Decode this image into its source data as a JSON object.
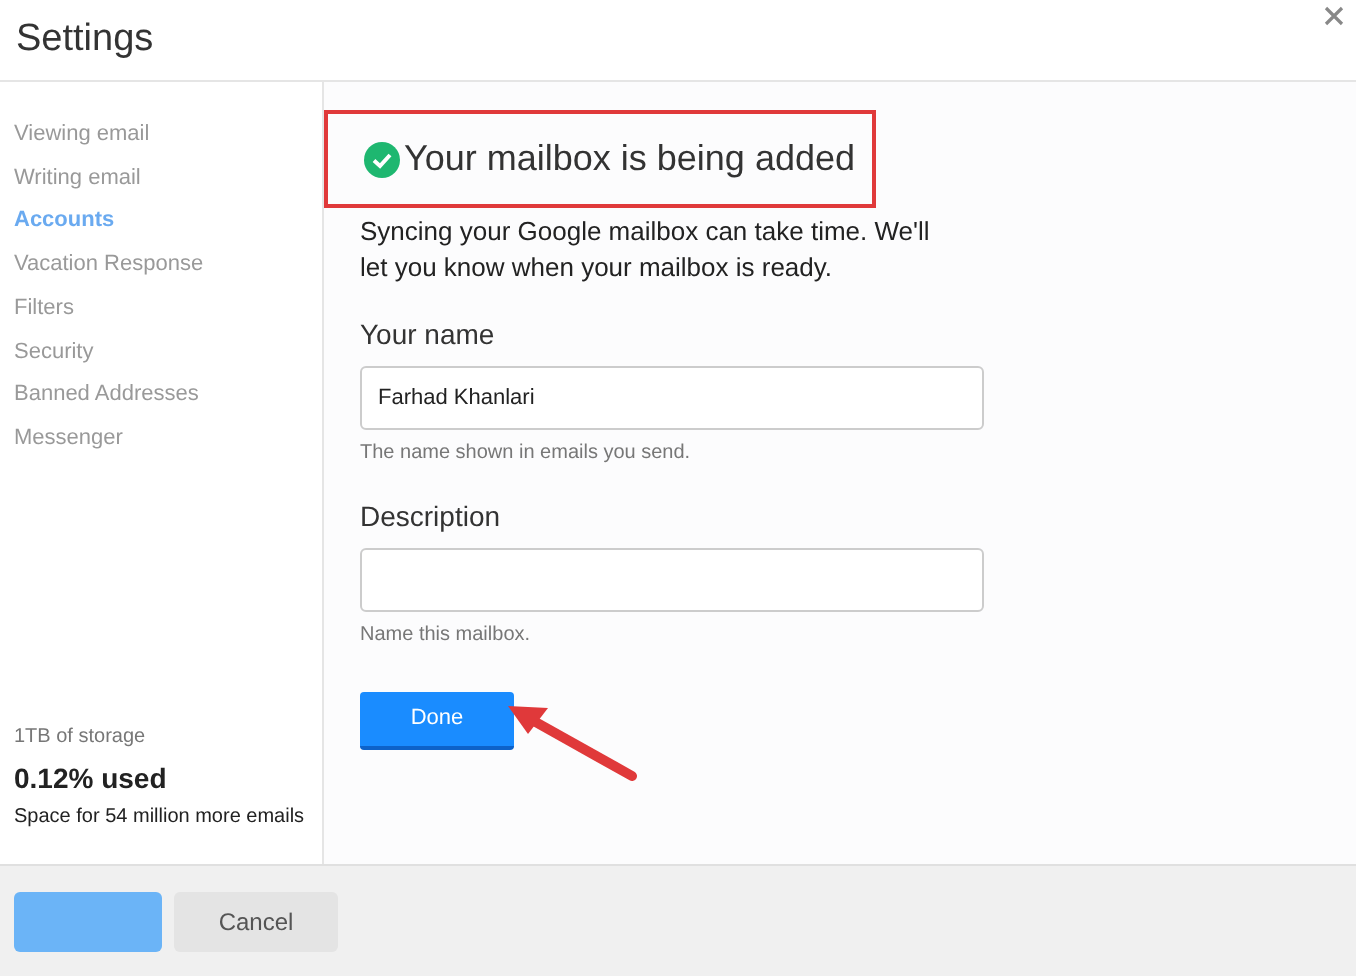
{
  "window": {
    "title": "Settings"
  },
  "sidebar": {
    "items": [
      {
        "label": "Viewing email",
        "selected": false
      },
      {
        "label": "Writing email",
        "selected": false
      },
      {
        "label": "Accounts",
        "selected": true
      },
      {
        "label": "Vacation Response",
        "selected": false
      },
      {
        "label": "Filters",
        "selected": false
      },
      {
        "label": "Security",
        "selected": false
      },
      {
        "label": "Banned Addresses",
        "selected": false
      },
      {
        "label": "Messenger",
        "selected": false
      }
    ],
    "storage": {
      "label": "1TB of storage",
      "usage": "0.12% used",
      "detail": "Space for 54 million more emails"
    }
  },
  "content": {
    "heading": "Your mailbox is being added",
    "description": "Syncing your Google mailbox can take time. We'll let you know when your mailbox is ready.",
    "fields": [
      {
        "label": "Your name",
        "value": "Farhad Khanlari",
        "hint": "The name shown in emails you send."
      },
      {
        "label": "Description",
        "hint": "Name this mailbox."
      }
    ],
    "button": "Done"
  },
  "annotations": {
    "highlight_heading": true,
    "arrow_to_button": true
  },
  "footer": {
    "buttons": [
      {
        "kind": "primary",
        "disabled": true
      },
      {
        "kind": "secondary",
        "label": "Cancel",
        "disabled": false
      }
    ]
  }
}
